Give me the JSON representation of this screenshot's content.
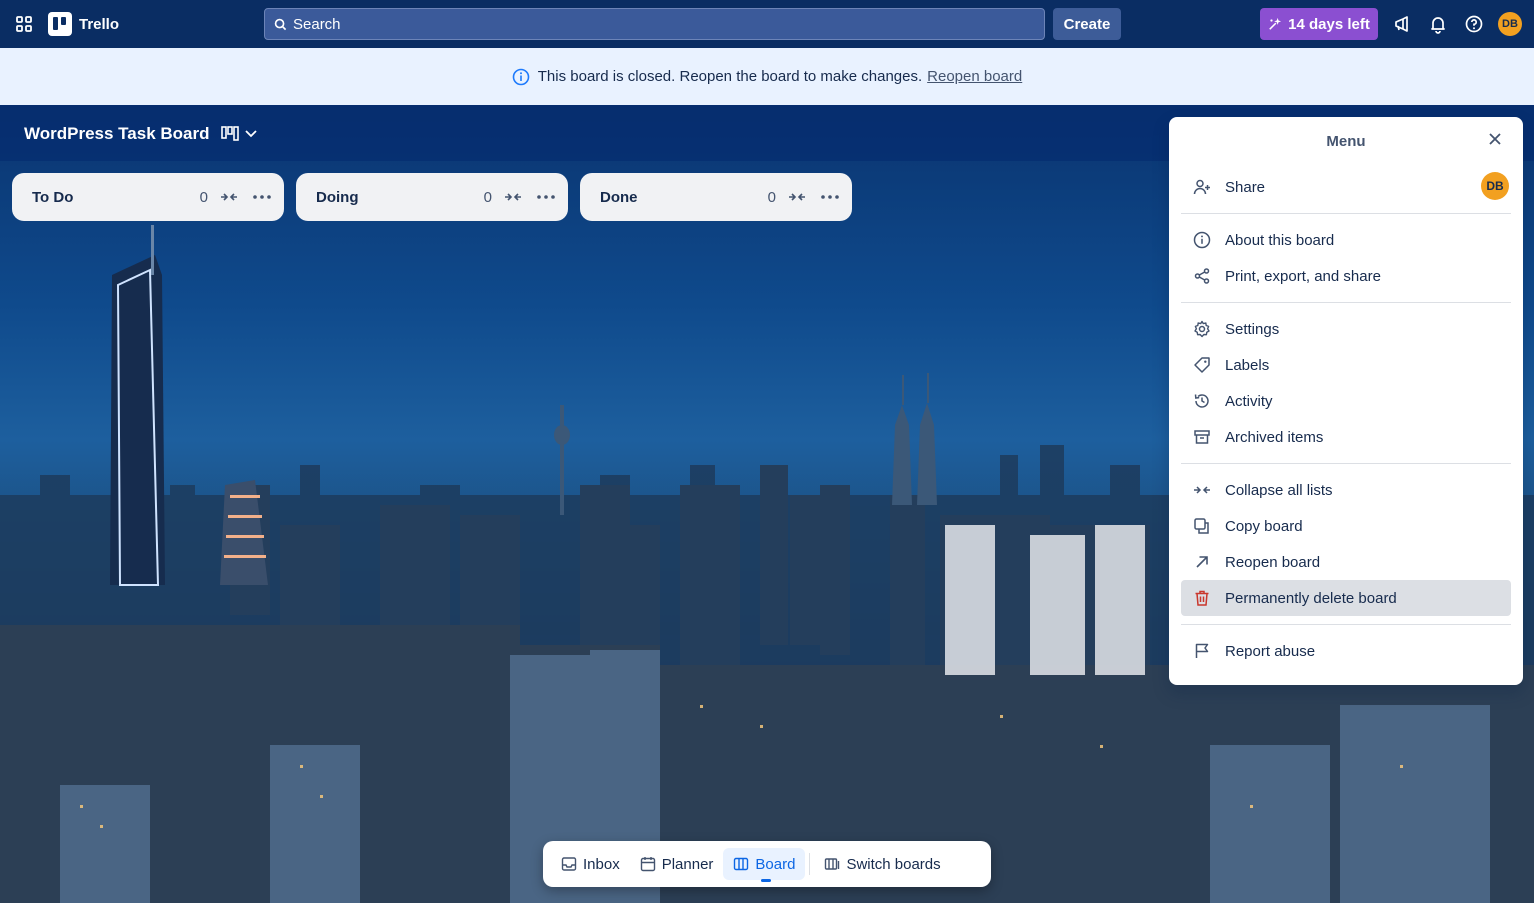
{
  "topnav": {
    "app_name": "Trello",
    "search_placeholder": "Search",
    "create_label": "Create",
    "trial_label": "14 days left",
    "avatar_initials": "DB",
    "icons": [
      "apps-grid-icon",
      "trello-logo-icon",
      "search-icon",
      "sparkle-icon",
      "megaphone-icon",
      "bell-icon",
      "help-icon"
    ]
  },
  "banner": {
    "message": "This board is closed. Reopen the board to make changes.",
    "link": "Reopen board"
  },
  "board": {
    "title": "WordPress Task Board"
  },
  "lists": [
    {
      "title": "To Do",
      "count": "0"
    },
    {
      "title": "Doing",
      "count": "0"
    },
    {
      "title": "Done",
      "count": "0"
    }
  ],
  "menu": {
    "title": "Menu",
    "share": "Share",
    "avatar_initials": "DB",
    "items": {
      "about": "About this board",
      "print": "Print, export, and share",
      "settings": "Settings",
      "labels": "Labels",
      "activity": "Activity",
      "archived": "Archived items",
      "collapse": "Collapse all lists",
      "copy": "Copy board",
      "reopen": "Reopen board",
      "delete": "Permanently delete board",
      "report": "Report abuse"
    }
  },
  "bottom_nav": {
    "inbox": "Inbox",
    "planner": "Planner",
    "board": "Board",
    "switch": "Switch boards"
  },
  "colors": {
    "nav_bg": "#0a2d63",
    "banner_bg": "#e9f2ff",
    "trial_bg": "#8b4fd1",
    "danger": "#c9372c",
    "active": "#0c66e4"
  }
}
